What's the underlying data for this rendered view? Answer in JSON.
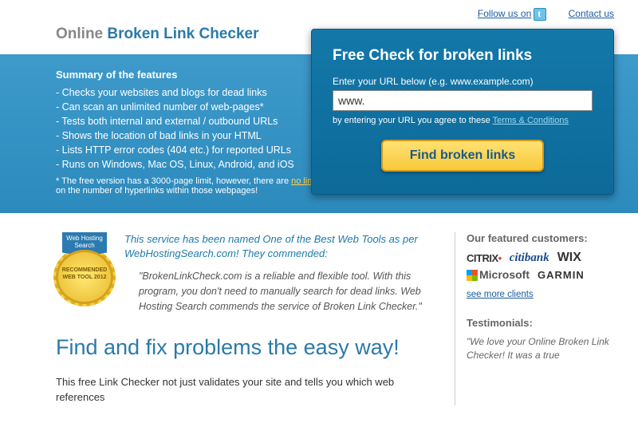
{
  "top": {
    "follow": "Follow us on",
    "contact": "Contact us"
  },
  "title": {
    "pre": "Online ",
    "brand": "Broken Link Checker"
  },
  "features": {
    "heading": "Summary of the features",
    "items": [
      "Checks your websites and blogs for dead links",
      "Can scan an unlimited number of web-pages*",
      "Tests both internal and external / outbound URLs",
      "Shows the location of bad links in your HTML",
      "Lists HTTP error codes (404 etc.) for reported URLs",
      "Runs on Windows, Mac OS, Linux, Android, and iOS"
    ],
    "note_pre": "*  The free version has a 3000-page limit, however, there are ",
    "note_link": "no limits",
    "note_post": " on the number of hyperlinks within those webpages!"
  },
  "box": {
    "heading": "Free Check for broken links",
    "label": "Enter your URL below (e.g. www.example.com)",
    "value": "www.",
    "agree_pre": "by entering your URL you agree to these ",
    "agree_link": "Terms & Conditions",
    "button": "Find broken links"
  },
  "badge": {
    "ribbon": "Web Hosting Search",
    "seal": "RECOMMENDED WEB TOOL 2012"
  },
  "endorse": {
    "line": "This service has been named One of the Best Web Tools as per WebHostingSearch.com! They commended:",
    "quote": "\"BrokenLinkCheck.com is a reliable and flexible tool. With this program, you don't need to manually search for dead links. Web Hosting Search commends the service of Broken Link Checker.\""
  },
  "h1": "Find and fix problems the easy way!",
  "bodyp": "This free Link Checker not just validates your site and tells you which web references",
  "right": {
    "feat": "Our featured customers:",
    "see": "see more clients",
    "test_h": "Testimonials:",
    "test_p": "\"We love your Online Broken Link Checker! It was a true"
  },
  "logos": {
    "citrix": "CITRIX",
    "citi": "citibank",
    "wix": "WIX",
    "ms": "Microsoft",
    "garmin": "GARMIN"
  }
}
